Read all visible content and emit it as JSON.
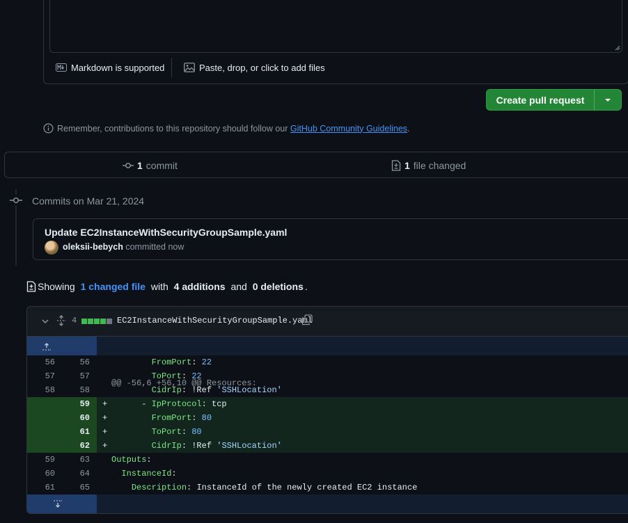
{
  "editor": {
    "markdown_label": "Markdown is supported",
    "attach_label": "Paste, drop, or click to add files"
  },
  "actions": {
    "create_pr_label": "Create pull request"
  },
  "notice": {
    "prefix": "Remember, contributions to this repository should follow our",
    "link": "GitHub Community Guidelines",
    "suffix": "."
  },
  "summary": {
    "commit_count": "1",
    "commit_label": "commit",
    "files_count": "1",
    "files_label": "file changed"
  },
  "timeline": {
    "date_label": "Commits on Mar 21, 2024",
    "commit": {
      "title": "Update EC2InstanceWithSecurityGroupSample.yaml",
      "author": "oleksii-bebych",
      "action": "committed now"
    }
  },
  "showing": {
    "prefix": "Showing",
    "files_link": "1 changed file",
    "with": "with",
    "additions": "4 additions",
    "and": "and",
    "deletions": "0 deletions",
    "period": "."
  },
  "diff": {
    "change_count": "4",
    "additions_blocks": 4,
    "neutral_blocks": 1,
    "file_name": "EC2InstanceWithSecurityGroupSample.yaml",
    "hunk_header": "@@ -56,6 +56,10 @@ Resources:",
    "lines": [
      {
        "old": "56",
        "new": "56",
        "sign": "",
        "indent": "        ",
        "key": "FromPort",
        "value": "22",
        "vtype": "num"
      },
      {
        "old": "57",
        "new": "57",
        "sign": "",
        "indent": "        ",
        "key": "ToPort",
        "value": "22",
        "vtype": "num"
      },
      {
        "old": "58",
        "new": "58",
        "sign": "",
        "indent": "        ",
        "key": "CidrIp",
        "value": "!Ref 'SSHLocation'",
        "vtype": "ref"
      },
      {
        "old": "",
        "new": "59",
        "sign": "+",
        "indent": "      - ",
        "key": "IpProtocol",
        "value": "tcp",
        "vtype": "plain"
      },
      {
        "old": "",
        "new": "60",
        "sign": "+",
        "indent": "        ",
        "key": "FromPort",
        "value": "80",
        "vtype": "num"
      },
      {
        "old": "",
        "new": "61",
        "sign": "+",
        "indent": "        ",
        "key": "ToPort",
        "value": "80",
        "vtype": "num"
      },
      {
        "old": "",
        "new": "62",
        "sign": "+",
        "indent": "        ",
        "key": "CidrIp",
        "value": "!Ref 'SSHLocation'",
        "vtype": "ref"
      },
      {
        "old": "59",
        "new": "63",
        "sign": "",
        "indent": "",
        "key": "Outputs",
        "value": "",
        "vtype": "plain"
      },
      {
        "old": "60",
        "new": "64",
        "sign": "",
        "indent": "  ",
        "key": "InstanceId",
        "value": "",
        "vtype": "plain"
      },
      {
        "old": "61",
        "new": "65",
        "sign": "",
        "indent": "    ",
        "key": "Description",
        "value": "InstanceId of the newly created EC2 instance",
        "vtype": "plain"
      }
    ]
  },
  "colors": {
    "primary_button": "#238636",
    "link": "#4493f8",
    "addition_bg": "#12261e",
    "addition_number_bg": "#1b4721",
    "hunk_bg": "#121d2f",
    "expander_bg": "#1f3c6b"
  },
  "icons": [
    "markdown-icon",
    "image-icon",
    "resize-grip-icon",
    "chevron-down-icon",
    "info-icon",
    "git-commit-icon",
    "file-diff-icon",
    "expand-up-icon",
    "expand-down-icon",
    "collapse-chevron-icon",
    "expand-all-icon",
    "copy-icon"
  ]
}
